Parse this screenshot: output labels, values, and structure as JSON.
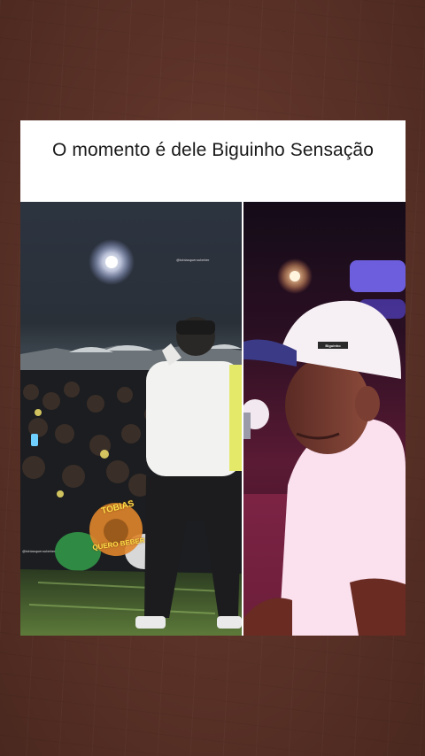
{
  "post": {
    "title": "O momento é dele Biguinho Sensação"
  },
  "left_photo": {
    "watermark_top": "@tobiasqueroubeber",
    "watermark_side": "@tobiasqueroubeber",
    "logo_line1": "TOBIAS",
    "logo_line2": "QUERO BEBER"
  },
  "right_photo": {
    "cap_text": "Biguinho Sensação"
  },
  "colors": {
    "background": "#5a3127",
    "card": "#ffffff",
    "title_text": "#1a1a1a"
  }
}
